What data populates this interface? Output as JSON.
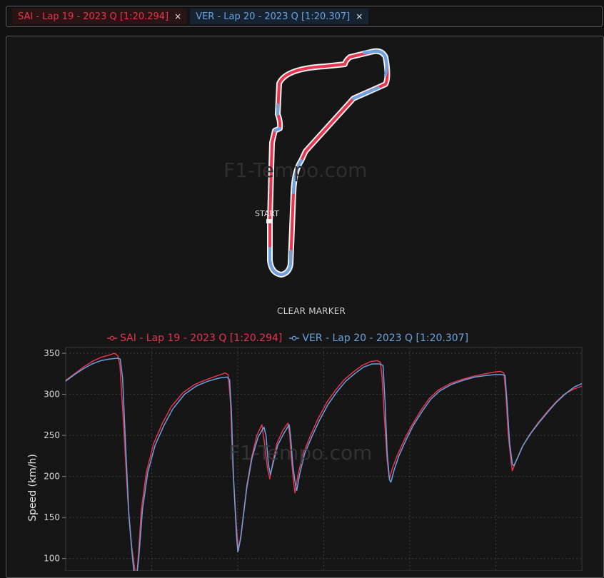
{
  "tabs": [
    {
      "label": "SAI - Lap 19 - 2023 Q [1:20.294]",
      "close": "×",
      "color": "#e8344f"
    },
    {
      "label": "VER - Lap 20 - 2023 Q [1:20.307]",
      "close": "×",
      "color": "#6aa3e0"
    }
  ],
  "track": {
    "start_label": "START"
  },
  "watermark": "F1-Tempo.com",
  "controls": {
    "clear_marker": "CLEAR MARKER"
  },
  "chart_data": {
    "type": "line",
    "ylabel": "Speed (km/h)",
    "xlabel": "",
    "ylim": [
      85,
      357
    ],
    "xlim": [
      0,
      100
    ],
    "yticks": [
      100,
      150,
      200,
      250,
      300,
      350
    ],
    "grid": true,
    "legend": "top",
    "series": [
      {
        "name": "SAI - Lap 19 - 2023 Q [1:20.294]",
        "color": "#e8344f",
        "points": [
          [
            0,
            317
          ],
          [
            3,
            325
          ],
          [
            6,
            333
          ],
          [
            9,
            340
          ],
          [
            12,
            345
          ],
          [
            15,
            348
          ],
          [
            16.6,
            350
          ],
          [
            17.8,
            347
          ],
          [
            18.5,
            335
          ],
          [
            19.8,
            260
          ],
          [
            21.2,
            170
          ],
          [
            22.5,
            115
          ],
          [
            23.6,
            86
          ],
          [
            24.1,
            73
          ],
          [
            24.8,
            105
          ],
          [
            25.8,
            160
          ],
          [
            27.5,
            205
          ],
          [
            30,
            240
          ],
          [
            33,
            265
          ],
          [
            36,
            285
          ],
          [
            40,
            302
          ],
          [
            44,
            312
          ],
          [
            48,
            318
          ],
          [
            52,
            323
          ],
          [
            54.4,
            326
          ],
          [
            55.4,
            324
          ],
          [
            56.2,
            290
          ],
          [
            57,
            210
          ],
          [
            58.2,
            140
          ],
          [
            58.9,
            110
          ],
          [
            59.8,
            130
          ],
          [
            61.8,
            190
          ],
          [
            63.5,
            225
          ],
          [
            65.2,
            250
          ],
          [
            66.9,
            263
          ],
          [
            67.8,
            240
          ],
          [
            68.8,
            210
          ],
          [
            69.6,
            197
          ],
          [
            70.5,
            215
          ],
          [
            72,
            240
          ],
          [
            74,
            256
          ],
          [
            75.8,
            265
          ],
          [
            76.4,
            250
          ],
          [
            77,
            220
          ],
          [
            77.8,
            190
          ],
          [
            78.2,
            180
          ],
          [
            79.2,
            202
          ],
          [
            81,
            228
          ],
          [
            83.5,
            250
          ],
          [
            86,
            270
          ],
          [
            89,
            290
          ],
          [
            92,
            305
          ],
          [
            95,
            318
          ],
          [
            98,
            327
          ],
          [
            101,
            335
          ],
          [
            104,
            340
          ],
          [
            106.3,
            341
          ],
          [
            107.3,
            339
          ],
          [
            107.9,
            320
          ],
          [
            108.7,
            270
          ],
          [
            109.6,
            220
          ],
          [
            110.4,
            197
          ],
          [
            111.4,
            210
          ],
          [
            113,
            225
          ],
          [
            115.5,
            245
          ],
          [
            118,
            262
          ],
          [
            121,
            280
          ],
          [
            124,
            295
          ],
          [
            127,
            305
          ],
          [
            131,
            313
          ],
          [
            135,
            318
          ],
          [
            139,
            322
          ],
          [
            143,
            325
          ],
          [
            146,
            327
          ],
          [
            148.3,
            328
          ],
          [
            149.4,
            326
          ],
          [
            150.1,
            300
          ],
          [
            150.9,
            250
          ],
          [
            151.8,
            220
          ],
          [
            152.3,
            207
          ],
          [
            153.5,
            218
          ],
          [
            155.5,
            235
          ],
          [
            158,
            250
          ],
          [
            161,
            265
          ],
          [
            164,
            278
          ],
          [
            167,
            290
          ],
          [
            170,
            300
          ],
          [
            173,
            306
          ],
          [
            176,
            310
          ]
        ]
      },
      {
        "name": "VER - Lap 20 - 2023 Q [1:20.307]",
        "color": "#6aa3e0",
        "points": [
          [
            0,
            316
          ],
          [
            3,
            324
          ],
          [
            6,
            331
          ],
          [
            9,
            337
          ],
          [
            12,
            341
          ],
          [
            15,
            343
          ],
          [
            17.7,
            344
          ],
          [
            18.6,
            343
          ],
          [
            19.4,
            320
          ],
          [
            20.4,
            240
          ],
          [
            21.6,
            150
          ],
          [
            22.8,
            100
          ],
          [
            23.4,
            80
          ],
          [
            24.2,
            78
          ],
          [
            24.9,
            100
          ],
          [
            26.2,
            160
          ],
          [
            28,
            205
          ],
          [
            30.5,
            238
          ],
          [
            33.5,
            262
          ],
          [
            36.5,
            282
          ],
          [
            40.5,
            300
          ],
          [
            44.5,
            310
          ],
          [
            48.5,
            316
          ],
          [
            52.5,
            320
          ],
          [
            55,
            321
          ],
          [
            55.9,
            318
          ],
          [
            56.5,
            280
          ],
          [
            57.2,
            200
          ],
          [
            58.2,
            130
          ],
          [
            58.7,
            108
          ],
          [
            59.7,
            125
          ],
          [
            61.7,
            185
          ],
          [
            63.5,
            222
          ],
          [
            65.6,
            248
          ],
          [
            67.6,
            260
          ],
          [
            68.3,
            250
          ],
          [
            69.1,
            215
          ],
          [
            69.8,
            202
          ],
          [
            70.6,
            214
          ],
          [
            72.3,
            238
          ],
          [
            74.3,
            252
          ],
          [
            76.2,
            263
          ],
          [
            76.7,
            248
          ],
          [
            77.4,
            215
          ],
          [
            78.3,
            190
          ],
          [
            78.8,
            183
          ],
          [
            79.8,
            203
          ],
          [
            81.5,
            228
          ],
          [
            84,
            249
          ],
          [
            86.5,
            268
          ],
          [
            89.5,
            288
          ],
          [
            92.5,
            303
          ],
          [
            95.5,
            316
          ],
          [
            98.5,
            325
          ],
          [
            101.5,
            333
          ],
          [
            104.5,
            337
          ],
          [
            107.2,
            337
          ],
          [
            108.2,
            335
          ],
          [
            108.9,
            290
          ],
          [
            109.6,
            230
          ],
          [
            110.4,
            196
          ],
          [
            110.9,
            193
          ],
          [
            112,
            208
          ],
          [
            113.6,
            225
          ],
          [
            116,
            244
          ],
          [
            118.5,
            262
          ],
          [
            121.5,
            279
          ],
          [
            124.5,
            294
          ],
          [
            127.5,
            304
          ],
          [
            131.5,
            312
          ],
          [
            135.5,
            317
          ],
          [
            139.5,
            321
          ],
          [
            143.5,
            323
          ],
          [
            146.5,
            324
          ],
          [
            148.8,
            324
          ],
          [
            149.8,
            323
          ],
          [
            150.5,
            290
          ],
          [
            151.4,
            240
          ],
          [
            152.3,
            215
          ],
          [
            152.8,
            213
          ],
          [
            154,
            222
          ],
          [
            156,
            238
          ],
          [
            158.5,
            252
          ],
          [
            161.5,
            266
          ],
          [
            164.5,
            279
          ],
          [
            167.5,
            291
          ],
          [
            170.5,
            301
          ],
          [
            173.5,
            309
          ],
          [
            176,
            313
          ]
        ]
      }
    ],
    "xdomain_visible": [
      0,
      176
    ]
  }
}
